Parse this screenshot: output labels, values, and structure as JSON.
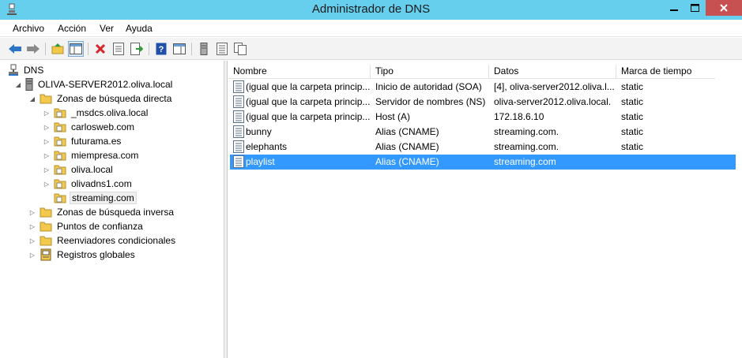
{
  "window": {
    "title": "Administrador de DNS",
    "minimize_icon": "minimize-icon",
    "maximize_icon": "maximize-icon",
    "close_icon": "close-icon"
  },
  "menu": {
    "items": [
      "Archivo",
      "Acción",
      "Ver",
      "Ayuda"
    ]
  },
  "toolbar": {
    "icons": [
      "back-arrow-icon",
      "forward-arrow-icon",
      "up-folder-icon",
      "show-hide-console-tree-icon",
      "delete-icon",
      "properties-icon",
      "export-list-icon",
      "help-icon",
      "show-hide-action-pane-icon",
      "server-icon",
      "list-icon",
      "copy-icon"
    ]
  },
  "tree": {
    "root": "DNS",
    "server": "OLIVA-SERVER2012.oliva.local",
    "forward_zones": "Zonas de búsqueda directa",
    "zones": [
      "_msdcs.oliva.local",
      "carlosweb.com",
      "futurama.es",
      "miempresa.com",
      "oliva.local",
      "olivadns1.com",
      "streaming.com"
    ],
    "reverse_zones": "Zonas de búsqueda inversa",
    "trust_points": "Puntos de confianza",
    "conditional_forwarders": "Reenviadores condicionales",
    "global_logs": "Registros globales"
  },
  "table": {
    "columns": [
      "Nombre",
      "Tipo",
      "Datos",
      "Marca de tiempo"
    ],
    "rows": [
      {
        "name": "(igual que la carpeta princip...",
        "type": "Inicio de autoridad (SOA)",
        "data": "[4], oliva-server2012.oliva.l...",
        "timestamp": "static"
      },
      {
        "name": "(igual que la carpeta princip...",
        "type": "Servidor de nombres (NS)",
        "data": "oliva-server2012.oliva.local.",
        "timestamp": "static"
      },
      {
        "name": "(igual que la carpeta princip...",
        "type": "Host (A)",
        "data": "172.18.6.10",
        "timestamp": "static"
      },
      {
        "name": "bunny",
        "type": "Alias (CNAME)",
        "data": "streaming.com.",
        "timestamp": "static"
      },
      {
        "name": "elephants",
        "type": "Alias (CNAME)",
        "data": "streaming.com.",
        "timestamp": "static"
      },
      {
        "name": "playlist",
        "type": "Alias (CNAME)",
        "data": "streaming.com",
        "timestamp": ""
      }
    ],
    "selected_index": 5
  },
  "colors": {
    "titlebar": "#66cfee",
    "close_button": "#c75050",
    "selection": "#3399ff",
    "folder": "#f2c94c"
  }
}
